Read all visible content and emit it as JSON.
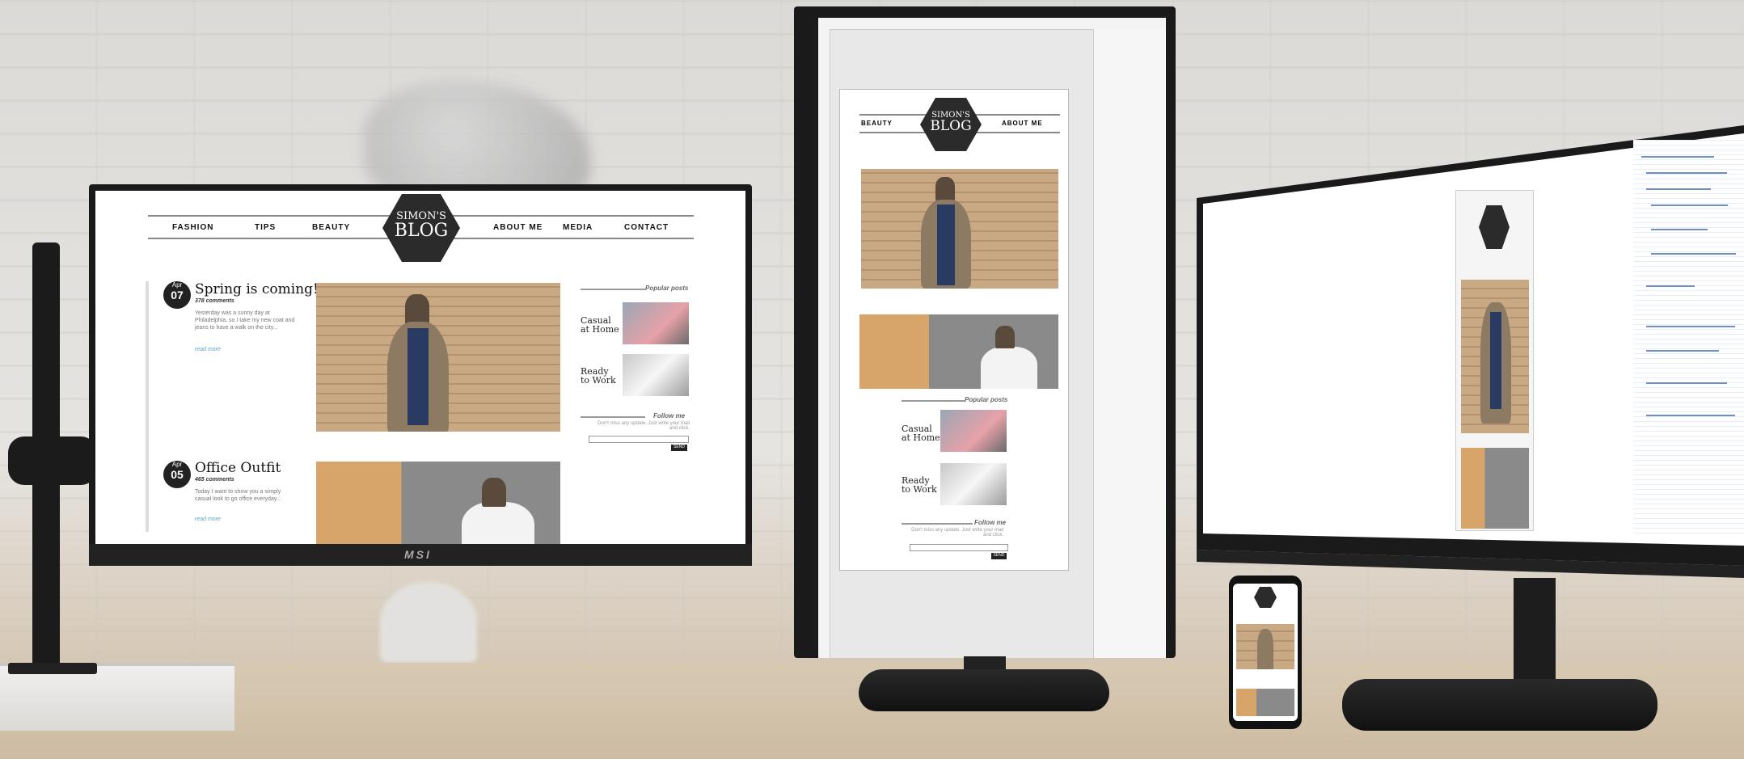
{
  "blog": {
    "logo_line1": "SIMON'S",
    "logo_line2": "BLOG",
    "nav": [
      "FASHION",
      "TIPS",
      "BEAUTY",
      "ABOUT ME",
      "MEDIA",
      "CONTACT"
    ],
    "posts": [
      {
        "month": "Apr",
        "day": "07",
        "title": "Spring is coming!",
        "comments": "378 comments",
        "excerpt": "Yesterday was a sunny day at Philadelphia, so I take my new coat and jeans to have a walk on the city...",
        "read_more": "read more"
      },
      {
        "month": "Apr",
        "day": "05",
        "title": "Office Outfit",
        "comments": "465 comments",
        "excerpt": "Today I want to show you a simply casual look to go office everyday...",
        "read_more": "read more"
      }
    ],
    "sidebar": {
      "popular_heading": "Popular posts",
      "popular": [
        {
          "title_line1": "Casual",
          "title_line2": "at Home"
        },
        {
          "title_line1": "Ready",
          "title_line2": "to Work"
        }
      ],
      "follow_heading": "Follow me",
      "follow_text": "Don't miss any update. Just write your mail and click.",
      "send_label": "SEND"
    }
  },
  "vertical_nav": [
    "BEAUTY",
    "ABOUT ME"
  ],
  "brand": "MSI",
  "colors": {
    "accent_link": "#5aa5c8",
    "hex_logo": "#2b2b2b"
  }
}
